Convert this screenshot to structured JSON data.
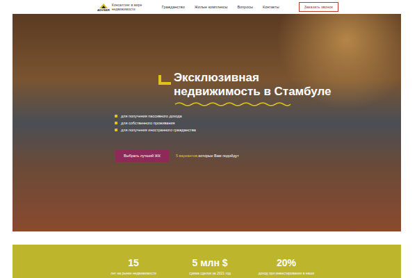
{
  "header": {
    "logo": {
      "brand": "ADVISER",
      "tagline": "Консалтинг в мире недвижимости"
    },
    "nav": [
      {
        "label": "Гражданство"
      },
      {
        "label": "Жилые комплексы"
      },
      {
        "label": "Вопросы"
      },
      {
        "label": "Контакты"
      }
    ],
    "cta": "Заказать звонок"
  },
  "hero": {
    "title_lines": [
      "Эксклюзивная",
      "недвижимость в Стамбуле"
    ],
    "bullets": [
      "для получения пассивного дохода",
      "для собственного проживания",
      "для получения иностранного гражданства"
    ],
    "button": "Выбрать лучший ЖК",
    "note": {
      "highlight": "5 вариантов,",
      "text": "которые Вам подойдут"
    }
  },
  "stats": [
    {
      "value": "15",
      "label": "лет на рынке недвижимости"
    },
    {
      "value": "5 млн $",
      "label": "сумма сделок за 2021 год"
    },
    {
      "value": "20%",
      "label": "доход при инвестировании в наши"
    }
  ]
}
